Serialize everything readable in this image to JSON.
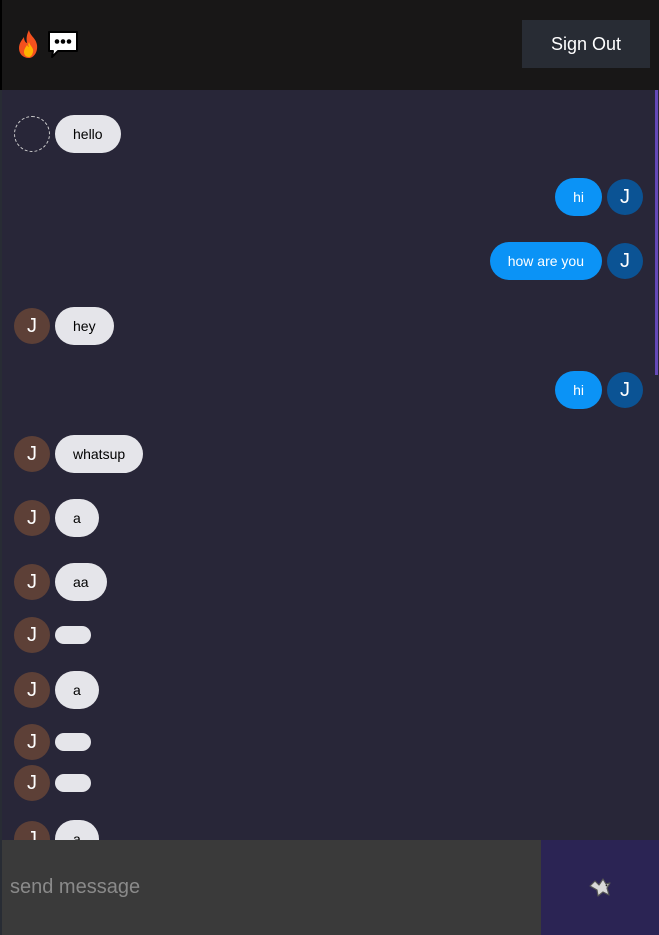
{
  "header": {
    "signout_label": "Sign Out",
    "logo_icons": [
      "fire-icon",
      "speech-bubble-icon"
    ]
  },
  "messages": [
    {
      "side": "received",
      "avatar": "",
      "avatar_empty": true,
      "text": "hello"
    },
    {
      "side": "sent",
      "avatar": "J",
      "text": "hi"
    },
    {
      "side": "sent",
      "avatar": "J",
      "text": "how are you"
    },
    {
      "side": "received",
      "avatar": "J",
      "text": "hey"
    },
    {
      "side": "sent",
      "avatar": "J",
      "text": "hi"
    },
    {
      "side": "received",
      "avatar": "J",
      "text": "whatsup"
    },
    {
      "side": "received",
      "avatar": "J",
      "text": "a"
    },
    {
      "side": "received",
      "avatar": "J",
      "text": "aa"
    },
    {
      "side": "received",
      "avatar": "J",
      "text": ""
    },
    {
      "side": "received",
      "avatar": "J",
      "text": "a"
    },
    {
      "side": "received",
      "avatar": "J",
      "text": ""
    },
    {
      "side": "received",
      "avatar": "J",
      "text": ""
    },
    {
      "side": "received",
      "avatar": "J",
      "text": "a"
    }
  ],
  "composer": {
    "placeholder": "send message",
    "send_icon": "dove-icon"
  },
  "colors": {
    "header_bg": "#181717",
    "chat_bg": "#282638",
    "received_bubble": "#e5e5ea",
    "sent_bubble": "#0b93f6",
    "received_avatar": "#5d4037",
    "sent_avatar": "#0b5394",
    "send_button_bg": "#2b2454",
    "scroll_thumb": "#6649b8"
  }
}
